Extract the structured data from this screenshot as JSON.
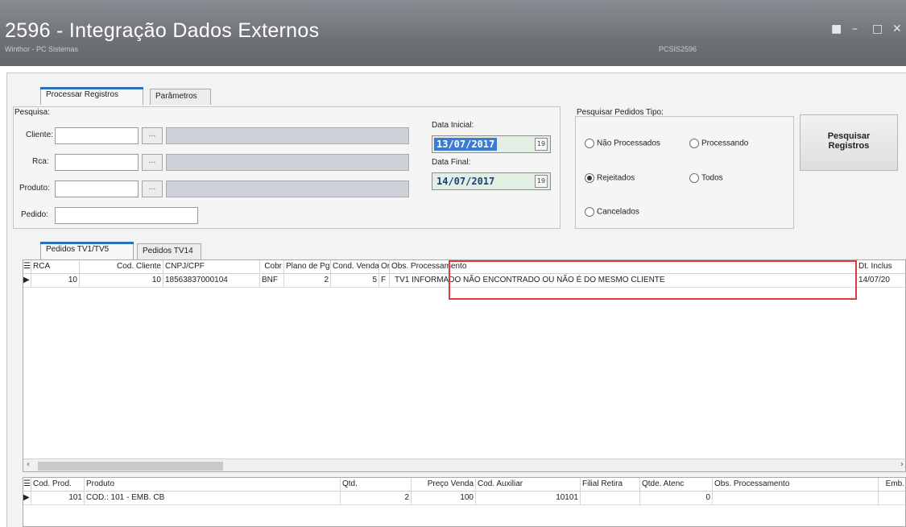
{
  "window": {
    "title": "2596 - Integração Dados Externos",
    "subtitle": "Winthor - PC Sistemas",
    "code": "PCSIS2596",
    "controls": [
      "■",
      "–",
      "□",
      "✕"
    ]
  },
  "tabs_main": [
    "Processar Registros",
    "Parâmetros"
  ],
  "search": {
    "group_label": "Pesquisa:",
    "cliente_label": "Cliente:",
    "rca_label": "Rca:",
    "produto_label": "Produto:",
    "pedido_label": "Pedido:",
    "ellipsis": "...",
    "data_inicial_label": "Data Inicial:",
    "data_inicial": "13/07/2017",
    "data_final_label": "Data Final:",
    "data_final": "14/07/2017",
    "calendar_glyph": "19"
  },
  "tipo": {
    "group_label": "Pesquisar Pedidos Tipo:",
    "options": [
      {
        "label": "Não Processados",
        "selected": false
      },
      {
        "label": "Processando",
        "selected": false
      },
      {
        "label": "Rejeitados",
        "selected": true
      },
      {
        "label": "Todos",
        "selected": false
      },
      {
        "label": "Cancelados",
        "selected": false
      }
    ]
  },
  "search_button": {
    "line1": "Pesquisar",
    "line2": "Registros"
  },
  "tabs_pedidos": [
    "Pedidos TV1/TV5",
    "Pedidos TV14"
  ],
  "pedidos_grid": {
    "columns": [
      "RCA",
      "Cod. Cliente",
      "CNPJ/CPF",
      "Cobr",
      "Plano de Pgt",
      "Cond. Venda",
      "Or",
      "Obs. Processamento",
      "Dt. Inclus"
    ],
    "rows": [
      {
        "rca": "10",
        "cod_cliente": "10",
        "cnpj": "18563837000104",
        "cobr": "BNF",
        "plano": "2",
        "cond": "5",
        "or": "F",
        "obs": "TV1 INFORMADO NÃO ENCONTRADO OU NÃO É DO MESMO CLIENTE",
        "dt": "14/07/20"
      }
    ],
    "row_indicator": "▶",
    "corner": "☰"
  },
  "itens_grid": {
    "columns": [
      "Cod. Prod.",
      "Produto",
      "Qtd.",
      "Preço Venda",
      "Cod. Auxiliar",
      "Filial Retira",
      "Qtde. Atenc",
      "Obs. Processamento",
      "Emb."
    ],
    "rows": [
      {
        "cod": "101",
        "produto": "COD.: 101 - EMB. CB",
        "qtd": "2",
        "preco": "100",
        "aux": "10101",
        "filial": "",
        "qtde": "0",
        "obs": "",
        "emb": ""
      }
    ],
    "row_indicator": "▶",
    "corner": "☰"
  },
  "colors": {
    "tab_accent": "#2e73b8",
    "highlight": "#e03a3a",
    "date_selected": "#3a7bd5"
  }
}
